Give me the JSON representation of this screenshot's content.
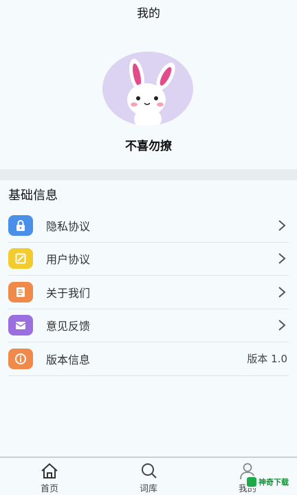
{
  "header": {
    "title": "我的"
  },
  "profile": {
    "nickname": "不喜勿撩"
  },
  "section": {
    "title": "基础信息"
  },
  "menu": [
    {
      "label": "隐私协议",
      "icon": "lock-icon",
      "color": "#4a90e8"
    },
    {
      "label": "用户协议",
      "icon": "edit-note-icon",
      "color": "#f2cc2e"
    },
    {
      "label": "关于我们",
      "icon": "document-icon",
      "color": "#ef8a4b"
    },
    {
      "label": "意见反馈",
      "icon": "mail-icon",
      "color": "#9b6fe0"
    },
    {
      "label": "版本信息",
      "icon": "info-icon",
      "color": "#ef8a4b",
      "value": "版本 1.0"
    }
  ],
  "tabbar": [
    {
      "label": "首页",
      "icon": "home-icon"
    },
    {
      "label": "词库",
      "icon": "search-icon"
    },
    {
      "label": "我的",
      "icon": "user-icon"
    }
  ],
  "watermark": {
    "text": "神奇下载"
  }
}
